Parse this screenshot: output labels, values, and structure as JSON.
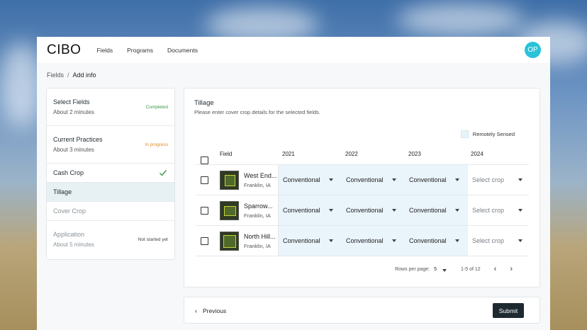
{
  "app": {
    "logo": "CIBO",
    "avatar_initials": "OP"
  },
  "nav": [
    "Fields",
    "Programs",
    "Documents"
  ],
  "breadcrumb": {
    "root": "Fields",
    "separator": "/",
    "current": "Add info"
  },
  "steps": {
    "select_fields": {
      "title": "Select Fields",
      "sub": "About 2 minutes",
      "status": "Completed"
    },
    "current_practices": {
      "title": "Current Practices",
      "sub": "About 3 minutes",
      "status": "In progress"
    },
    "cash_crop": "Cash Crop",
    "tillage": "Tillage",
    "cover_crop": "Cover Crop",
    "application": {
      "title": "Application",
      "sub": "About 5 minutes",
      "status": "Not started yet"
    }
  },
  "section": {
    "title": "Tillage",
    "description": "Please enter cover crop details for the selected fields.",
    "legend": "Remotely Sensed"
  },
  "table": {
    "headers": {
      "field": "Field",
      "y2021": "2021",
      "y2022": "2022",
      "y2023": "2023",
      "y2024": "2024"
    },
    "rows": [
      {
        "name": "West End...",
        "location": "Franklin, IA",
        "y2021": "Conventional",
        "y2022": "Conventional",
        "y2023": "Conventional",
        "y2024": "Select crop"
      },
      {
        "name": "Sparrow...",
        "location": "Franklin, IA",
        "y2021": "Conventional",
        "y2022": "Conventional",
        "y2023": "Conventional",
        "y2024": "Select crop"
      },
      {
        "name": "North Hill...",
        "location": "Franklin, IA",
        "y2021": "Conventional",
        "y2022": "Conventional",
        "y2023": "Conventional",
        "y2024": "Select crop"
      }
    ]
  },
  "pagination": {
    "rows_label": "Rows per page:",
    "rows_value": "5",
    "range": "1-5 of 12",
    "prev_icon": "‹",
    "next_icon": "›"
  },
  "footer": {
    "previous": "Previous",
    "submit": "Submit"
  },
  "colors": {
    "accent": "#29c2d8",
    "remote_sensed": "#eaf4fb",
    "submit": "#1d2a30",
    "completed": "#3a9a4a",
    "in_progress": "#e08a2c"
  }
}
